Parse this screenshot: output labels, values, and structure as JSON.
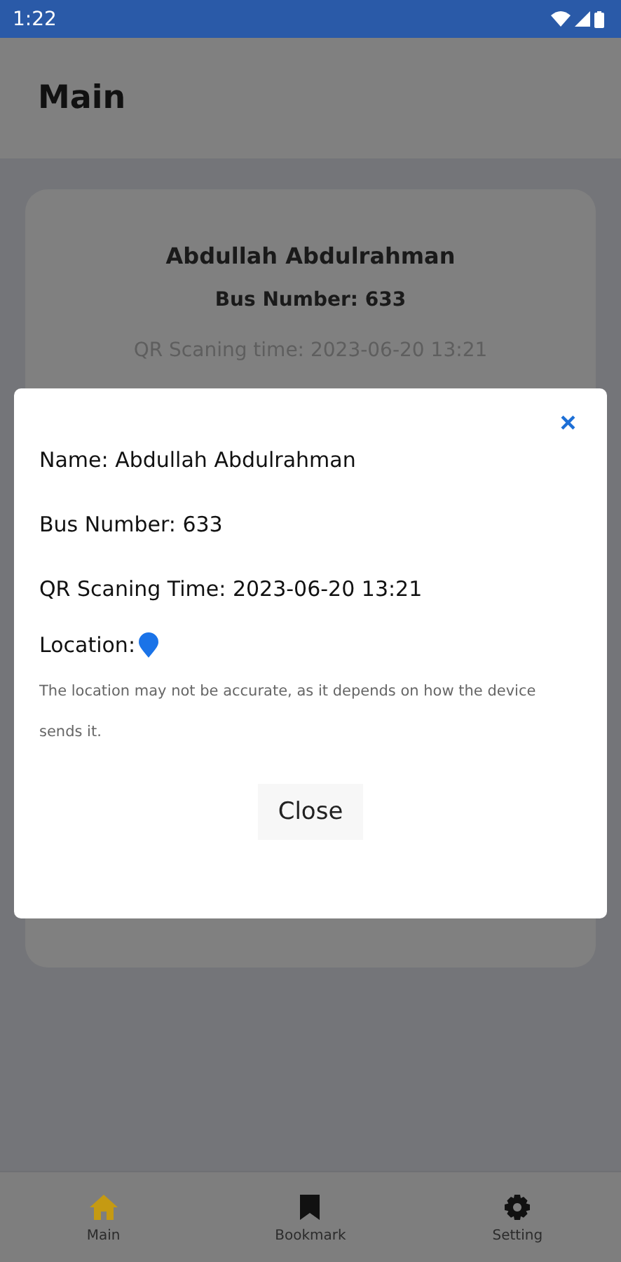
{
  "status_bar": {
    "time": "1:22"
  },
  "app_bar": {
    "title": "Main"
  },
  "card": {
    "name": "Abdullah Abdulrahman",
    "bus_number": "Bus Number: 633",
    "scan_time": "QR Scaning time: 2023-06-20 13:21"
  },
  "dialog": {
    "close_icon": "×",
    "name": "Name: Abdullah Abdulrahman",
    "bus_number": "Bus Number: 633",
    "scan_time": "QR Scaning Time: 2023-06-20 13:21",
    "location_label": "Location:",
    "note": "The location may not be accurate, as it depends on how the device sends it.",
    "close_button": "Close"
  },
  "bottom_nav": [
    {
      "kind": "home",
      "label": "Main",
      "selected": true
    },
    {
      "kind": "bookmark",
      "label": "Bookmark",
      "selected": false
    },
    {
      "kind": "settings",
      "label": "Setting",
      "selected": false
    }
  ]
}
